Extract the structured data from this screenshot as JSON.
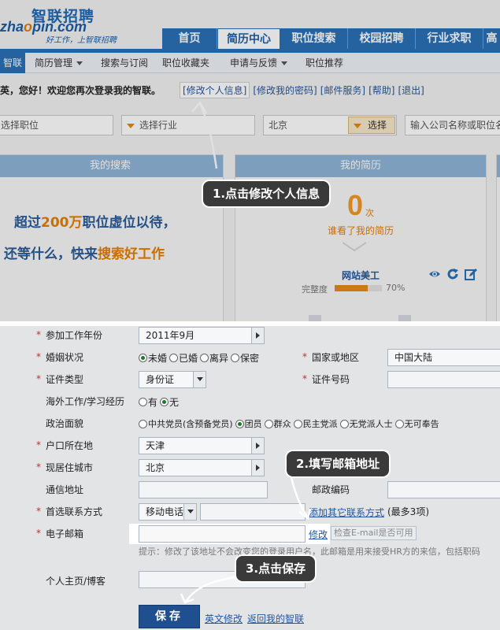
{
  "logo": {
    "cn": "智联招聘",
    "en_a": "zha",
    "en_o": "o",
    "en_b": "pin.com",
    "slogan": "好工作，上智联招聘"
  },
  "mainnav": [
    {
      "label": "首页",
      "w": 70
    },
    {
      "label": "简历中心",
      "w": 80,
      "active": true
    },
    {
      "label": "职位搜索",
      "w": 86
    },
    {
      "label": "校园招聘",
      "w": 86
    },
    {
      "label": "行业求职",
      "w": 86
    },
    {
      "label": "高",
      "w": 22
    }
  ],
  "subnav": [
    "智联",
    "简历管理",
    "搜索与订阅",
    "职位收藏夹",
    "申请与反馈",
    "职位推荐"
  ],
  "welcome": {
    "text": "英，您好！欢迎您再次登录我的智联。",
    "links": [
      "[修改个人信息]",
      "[修改我的密码]",
      "[邮件服务]",
      "[帮助]",
      "[退出]"
    ]
  },
  "search": {
    "position": "选择职位",
    "industry": "选择行业",
    "city": "北京",
    "button": "选择",
    "company_placeholder": "输入公司名称或职位名"
  },
  "panels": {
    "left_title": "我的搜索",
    "right_title": "我的简历"
  },
  "promo": {
    "line1_a": "超过",
    "line1_b": "200万",
    "line1_c": "职位虚位以待，",
    "line2_a": "还等什么，快来",
    "line2_b": "搜索好工作"
  },
  "resume": {
    "views": "0",
    "unit": "次",
    "views_label": "谁看了我的简历",
    "name": "网站美工",
    "degree_label": "完整度",
    "progress": 0.7,
    "progress_text": "70%"
  },
  "callouts": {
    "c1": "1.点击修改个人信息",
    "c2": "2.填写邮箱地址",
    "c3": "3.点击保存"
  },
  "form": {
    "work_year_label": "参加工作年份",
    "work_year": "2011年9月",
    "marital_label": "婚姻状况",
    "marital_options": [
      "未婚",
      "已婚",
      "离异",
      "保密"
    ],
    "country_label": "国家或地区",
    "country": "中国大陆",
    "id_type_label": "证件类型",
    "id_type": "身份证",
    "id_no_label": "证件号码",
    "overseas_label": "海外工作/学习经历",
    "overseas_options": [
      "有",
      "无"
    ],
    "politics_label": "政治面貌",
    "politics_options": [
      "中共党员(含预备党员)",
      "团员",
      "群众",
      "民主党派",
      "无党派人士",
      "无可奉告"
    ],
    "hukou_label": "户口所在地",
    "hukou": "天津",
    "city_label": "现居住城市",
    "city": "北京",
    "address_label": "通信地址",
    "zip_label": "邮政编码",
    "contact_label": "首选联系方式",
    "contact": "移动电话",
    "add_contact": "添加其它联系方式",
    "add_contact_note": "(最多3项)",
    "email_label": "电子邮箱",
    "email_modify": "修改",
    "email_check": "检查E-mail是否可用",
    "email_hint": "提示：修改了该地址不会改变您的登录用户名，此邮箱是用来接受HR方的来信，包括职码",
    "homepage_label": "个人主页/博客",
    "save": "保存",
    "en_modify": "英文修改",
    "back": "返回我的智联"
  }
}
